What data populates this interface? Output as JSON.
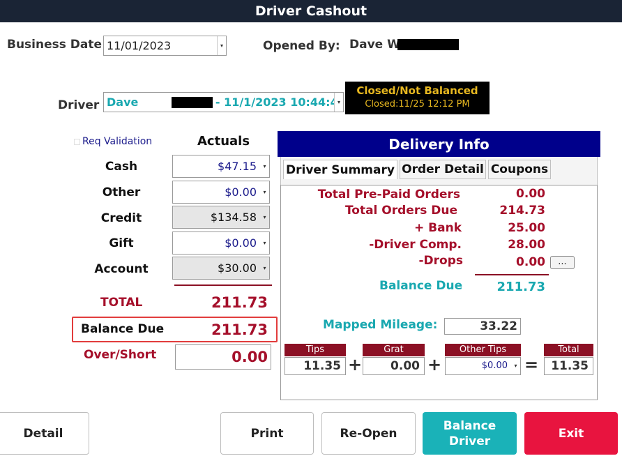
{
  "window": {
    "title": "Driver Cashout"
  },
  "header": {
    "business_date_label": "Business Date",
    "business_date_value": "11/01/2023",
    "opened_by_label": "Opened By:",
    "opened_by_value": "Dave W",
    "driver_label": "Driver",
    "driver_value_prefix": "Dave",
    "driver_value_suffix": "- 11/1/2023 10:44:4!",
    "status_main": "Closed/Not Balanced",
    "status_sub": "Closed:11/25 12:12 PM"
  },
  "actuals": {
    "req_validation_label": "Req Validation",
    "column_title": "Actuals",
    "rows": [
      {
        "label": "Cash",
        "value": "$47.15"
      },
      {
        "label": "Other",
        "value": "$0.00"
      },
      {
        "label": "Credit",
        "value": "$134.58"
      },
      {
        "label": "Gift",
        "value": "$0.00"
      },
      {
        "label": "Account",
        "value": "$30.00"
      }
    ],
    "total_label": "TOTAL",
    "total_value": "211.73",
    "balance_due_label": "Balance Due",
    "balance_due_value": "211.73",
    "over_short_label": "Over/Short",
    "over_short_value": "0.00"
  },
  "delivery": {
    "title": "Delivery Info",
    "tabs": [
      {
        "label": "Driver Summary"
      },
      {
        "label": "Order Detail"
      },
      {
        "label": "Coupons"
      }
    ],
    "summary": [
      {
        "label": "Total Pre-Paid Orders",
        "value": "0.00"
      },
      {
        "label": "Total Orders Due",
        "value": "214.73"
      },
      {
        "label": "+ Bank",
        "value": "25.00"
      },
      {
        "label": "-Driver Comp.",
        "value": "28.00"
      },
      {
        "label": "-Drops",
        "value": "0.00"
      }
    ],
    "drops_button": "...",
    "balance_due_label": "Balance Due",
    "balance_due_value": "211.73",
    "mileage_label": "Mapped Mileage:",
    "mileage_value": "33.22",
    "tips": {
      "tips_label": "Tips",
      "tips_value": "11.35",
      "grat_label": "Grat",
      "grat_value": "0.00",
      "other_label": "Other Tips",
      "other_value": "$0.00",
      "total_label": "Total",
      "total_value": "11.35",
      "plus": "+",
      "equals": "="
    }
  },
  "buttons": {
    "detail": "Detail",
    "print": "Print",
    "reopen": "Re-Open",
    "balance_line1": "Balance",
    "balance_line2": "Driver",
    "exit": "Exit"
  },
  "colors": {
    "titlebar": "#1a2435",
    "accent_red": "#a50f2a",
    "teal": "#1ab2b8",
    "exit_red": "#e8143f",
    "panel_blue": "#00008b"
  }
}
